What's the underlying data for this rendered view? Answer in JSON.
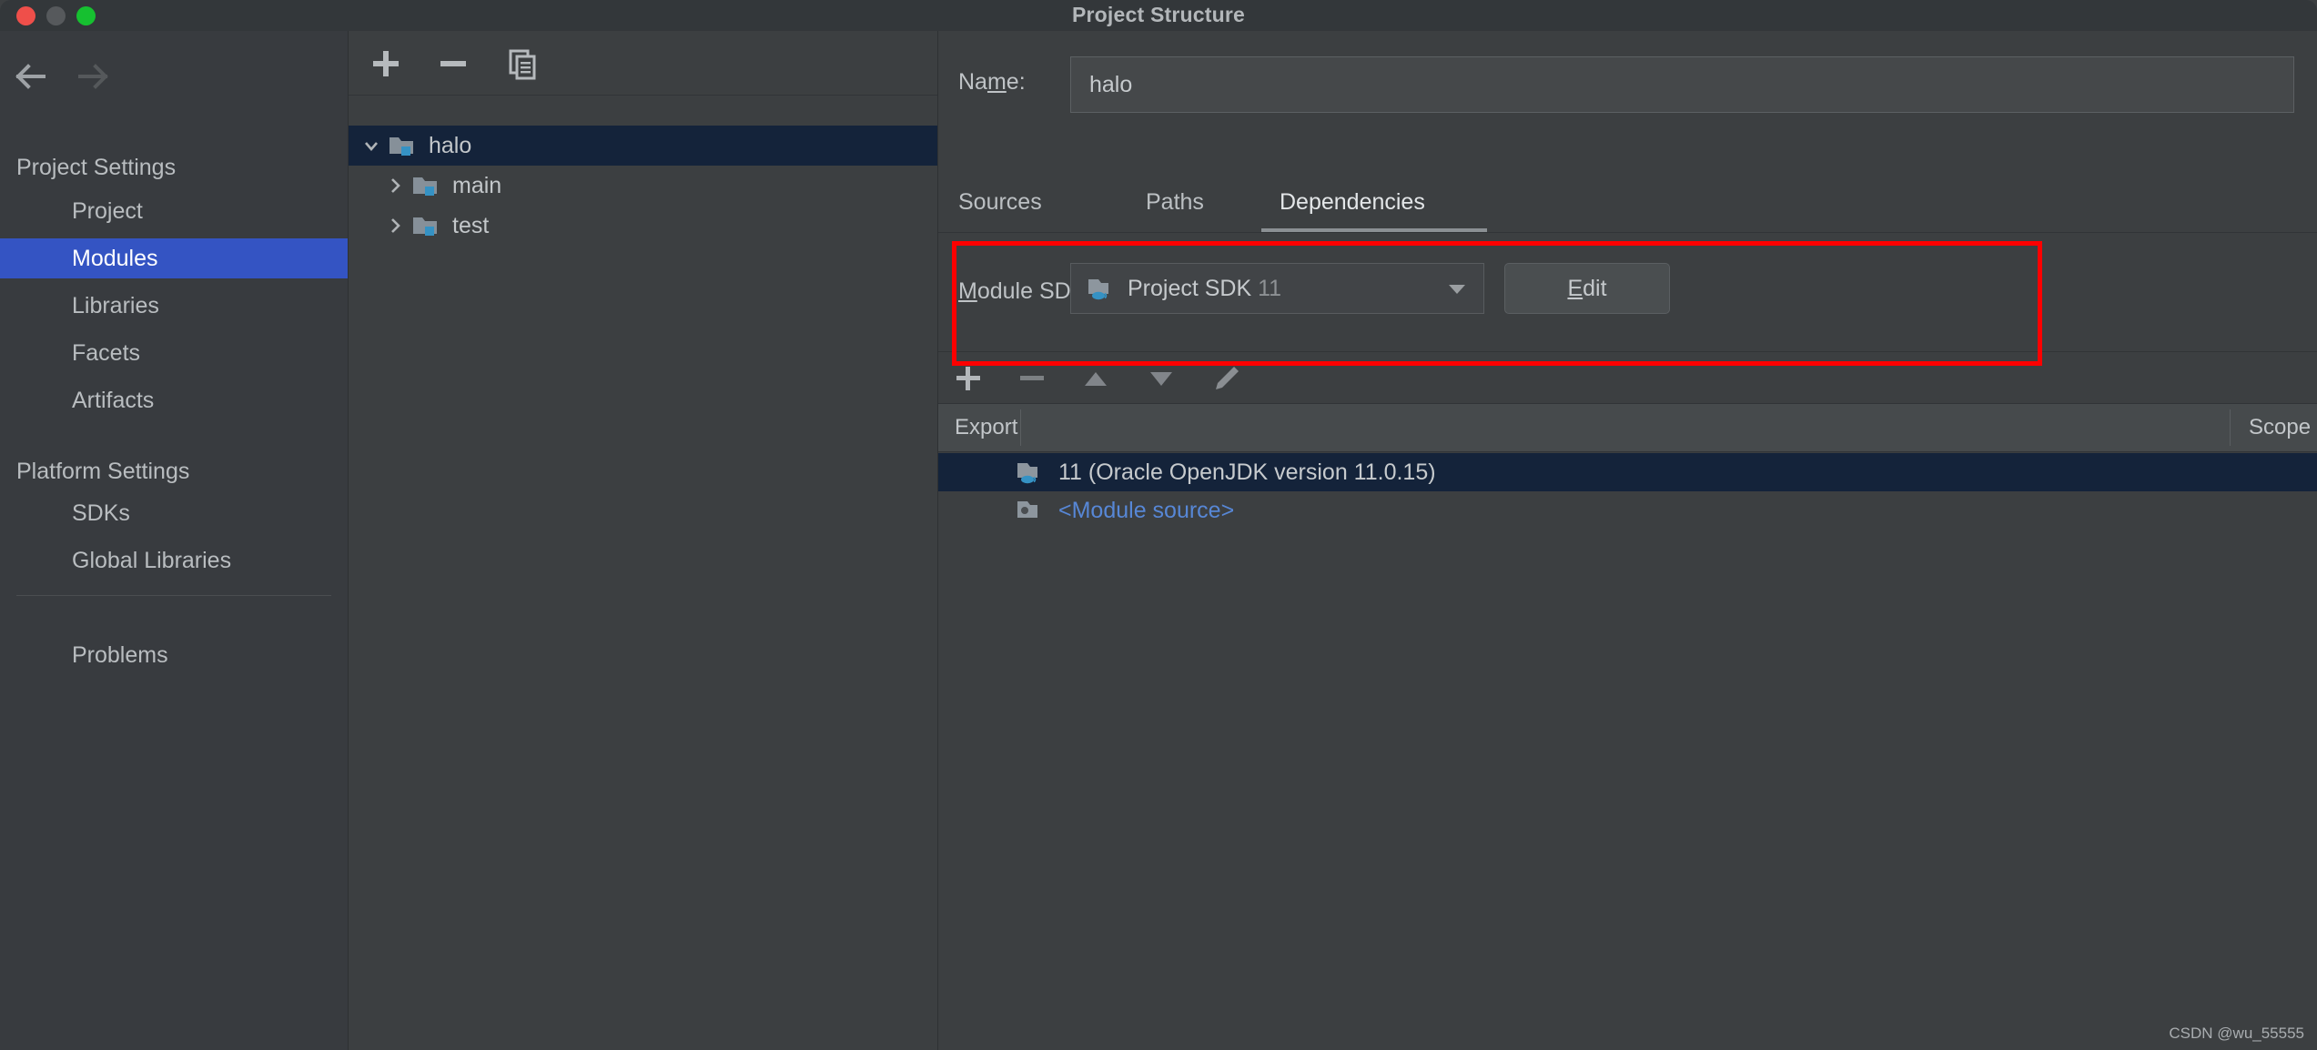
{
  "window": {
    "title": "Project Structure",
    "controls": [
      "close",
      "minimize",
      "zoom"
    ]
  },
  "nav": {
    "back_icon": "arrow-left-icon",
    "forward_icon": "arrow-right-icon"
  },
  "sidebar": {
    "sections": [
      {
        "title": "Project Settings"
      },
      {
        "title": "Platform Settings"
      }
    ],
    "project_items": [
      {
        "label": "Project",
        "selected": false
      },
      {
        "label": "Modules",
        "selected": true
      },
      {
        "label": "Libraries",
        "selected": false
      },
      {
        "label": "Facets",
        "selected": false
      },
      {
        "label": "Artifacts",
        "selected": false
      }
    ],
    "platform_items": [
      {
        "label": "SDKs",
        "selected": false
      },
      {
        "label": "Global Libraries",
        "selected": false
      }
    ],
    "other_items": [
      {
        "label": "Problems",
        "selected": false
      }
    ]
  },
  "tree_panel": {
    "toolbar": [
      {
        "name": "add-module-button",
        "icon": "plus-icon"
      },
      {
        "name": "remove-module-button",
        "icon": "minus-icon"
      },
      {
        "name": "copy-module-button",
        "icon": "copy-icon"
      }
    ],
    "rows": [
      {
        "label": "halo",
        "depth": 0,
        "expanded": true,
        "selected": true,
        "icon": "module-folder-icon"
      },
      {
        "label": "main",
        "depth": 1,
        "expanded": false,
        "selected": false,
        "icon": "module-folder-icon"
      },
      {
        "label": "test",
        "depth": 1,
        "expanded": false,
        "selected": false,
        "icon": "module-folder-icon"
      }
    ]
  },
  "detail": {
    "name_label": "Name:",
    "name_label_mnemonic": "m",
    "name_value": "halo",
    "name_placeholder": "",
    "tabs": [
      {
        "label": "Sources",
        "active": false
      },
      {
        "label": "Paths",
        "active": false
      },
      {
        "label": "Dependencies",
        "active": true
      }
    ],
    "sdk": {
      "label": "Module SDK:",
      "label_mnemonic": "M",
      "value": "Project SDK",
      "version": "11",
      "icon": "jdk-folder-icon",
      "dropdown_icon": "chevron-down-icon",
      "edit_label": "Edit",
      "edit_mnemonic": "E"
    },
    "dep_toolbar": [
      {
        "name": "add-dependency-button",
        "icon": "plus-icon"
      },
      {
        "name": "remove-dependency-button",
        "icon": "minus-icon"
      },
      {
        "name": "move-up-button",
        "icon": "triangle-up-icon"
      },
      {
        "name": "move-down-button",
        "icon": "triangle-down-icon"
      },
      {
        "name": "edit-dependency-button",
        "icon": "pencil-icon"
      }
    ],
    "table": {
      "columns": [
        "Export",
        "",
        "Scope"
      ],
      "rows": [
        {
          "export": "",
          "name": "11 (Oracle OpenJDK version 11.0.15)",
          "scope": "",
          "icon": "jdk-folder-icon",
          "selected": true,
          "link": false
        },
        {
          "export": "",
          "name": "<Module source>",
          "scope": "",
          "icon": "module-source-icon",
          "selected": false,
          "link": true
        }
      ]
    }
  },
  "annotation": {
    "type": "red-rectangle-highlight",
    "color": "#fe0000"
  },
  "watermark": {
    "text": "CSDN @wu_55555"
  },
  "colors": {
    "window_bg": "#3c3f41",
    "sidebar_bg": "#383b3f",
    "titlebar_bg": "#33373a",
    "selection_blue": "#3454c3",
    "tree_selection": "#14233a",
    "link_blue": "#5787d6",
    "accent_red": "#fe0000",
    "jdk_cup": "#3592c4"
  }
}
